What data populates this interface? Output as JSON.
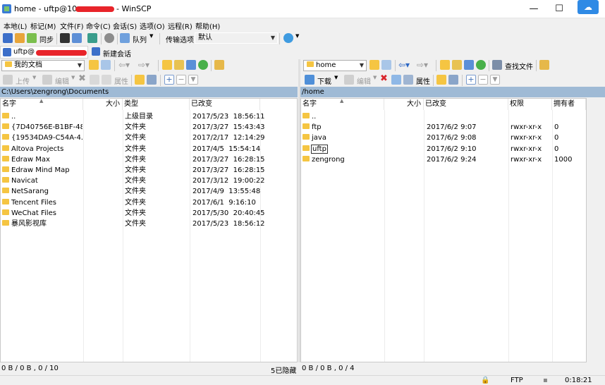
{
  "window": {
    "title_prefix": "home - uftp@",
    "title_host_visible": "10",
    "title_suffix": "- WinSCP",
    "buttons": {
      "minimize": "—",
      "maximize": "☐"
    }
  },
  "menu": [
    "本地(L)",
    "标记(M)",
    "文件(F)",
    "命令(C)",
    "会话(S)",
    "选项(O)",
    "远程(R)",
    "帮助(H)"
  ],
  "toolbar": {
    "sync_label": "同步",
    "queue_label": "队列",
    "transfer_options_label": "传输选项",
    "transfer_options_value": "默认"
  },
  "sessions": {
    "current_tab": "uftp@",
    "new_session_label": "新建会话"
  },
  "left": {
    "location_combo": "我的文档",
    "upload_label": "上传",
    "edit_label": "编辑",
    "properties_label": "属性",
    "path": "C:\\Users\\zengrong\\Documents",
    "columns": {
      "name": "名字",
      "size": "大小",
      "type": "类型",
      "modified": "已改变"
    },
    "rows": [
      {
        "name": "..",
        "size": "",
        "type": "上级目录",
        "modified": "2017/5/23  18:56:11"
      },
      {
        "name": "{7D40756E-B1BF-48...",
        "size": "",
        "type": "文件夹",
        "modified": "2017/3/27  15:43:43"
      },
      {
        "name": "{19534DA9-C54A-4...",
        "size": "",
        "type": "文件夹",
        "modified": "2017/2/17  12:14:29"
      },
      {
        "name": "Altova Projects",
        "size": "",
        "type": "文件夹",
        "modified": "2017/4/5  15:54:14"
      },
      {
        "name": "Edraw Max",
        "size": "",
        "type": "文件夹",
        "modified": "2017/3/27  16:28:15"
      },
      {
        "name": "Edraw Mind Map",
        "size": "",
        "type": "文件夹",
        "modified": "2017/3/27  16:28:15"
      },
      {
        "name": "Navicat",
        "size": "",
        "type": "文件夹",
        "modified": "2017/3/12  19:00:22"
      },
      {
        "name": "NetSarang",
        "size": "",
        "type": "文件夹",
        "modified": "2017/4/9  13:55:48"
      },
      {
        "name": "Tencent Files",
        "size": "",
        "type": "文件夹",
        "modified": "2017/6/1  9:16:10"
      },
      {
        "name": "WeChat Files",
        "size": "",
        "type": "文件夹",
        "modified": "2017/5/30  20:40:45"
      },
      {
        "name": "暴风影视库",
        "size": "",
        "type": "文件夹",
        "modified": "2017/5/23  18:56:12"
      }
    ],
    "status": "0 B / 0 B ,  0 / 10",
    "hidden": "5已隐藏"
  },
  "right": {
    "location_combo": "home",
    "find_files_label": "查找文件",
    "download_label": "下载",
    "edit_label": "编辑",
    "properties_label": "属性",
    "path": "/home",
    "columns": {
      "name": "名字",
      "size": "大小",
      "modified": "已改变",
      "perms": "权限",
      "owner": "拥有者"
    },
    "rows": [
      {
        "name": "..",
        "size": "",
        "modified": "",
        "perms": "",
        "owner": ""
      },
      {
        "name": "ftp",
        "size": "",
        "modified": "2017/6/2 9:07",
        "perms": "rwxr-xr-x",
        "owner": "0"
      },
      {
        "name": "java",
        "size": "",
        "modified": "2017/6/2 9:08",
        "perms": "rwxr-xr-x",
        "owner": "0"
      },
      {
        "name": "uftp",
        "size": "",
        "modified": "2017/6/2 9:10",
        "perms": "rwxr-xr-x",
        "owner": "0"
      },
      {
        "name": "zengrong",
        "size": "",
        "modified": "2017/6/2 9:24",
        "perms": "rwxr-xr-x",
        "owner": "1000"
      }
    ],
    "status": "0 B / 0 B ,  0 / 4"
  },
  "statusbar": {
    "protocol": "FTP",
    "elapsed": "0:18:21"
  },
  "colors": {
    "path_bar": "#9fbad5",
    "folder": "#f5c542",
    "redaction": "#e8242a",
    "cloud": "#2f8ae5"
  }
}
